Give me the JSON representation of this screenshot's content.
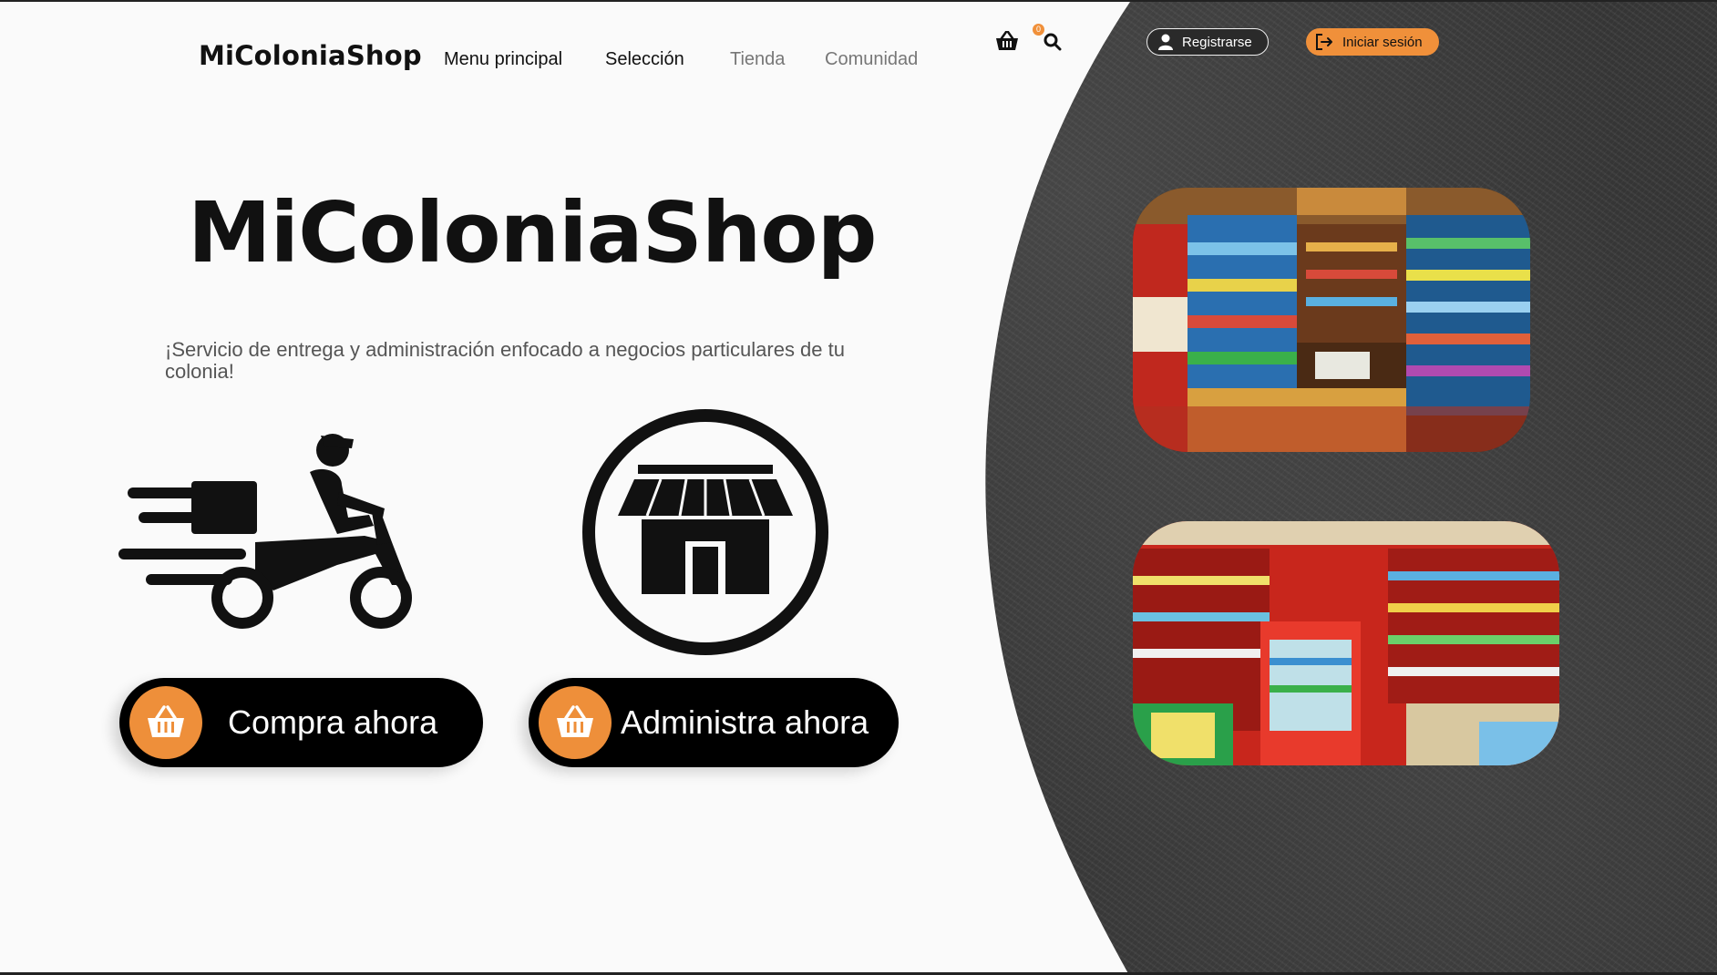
{
  "header": {
    "logo": "MiColoniaShop",
    "nav": [
      {
        "label": "Menu principal"
      },
      {
        "label": "Selección"
      },
      {
        "label": "Tienda"
      },
      {
        "label": "Comunidad"
      }
    ],
    "cart_count": "0",
    "cart_icon": "basket-icon",
    "search_icon": "search-icon",
    "register_label": "Registrarse",
    "login_label": "Iniciar sesión"
  },
  "hero": {
    "title": "MiColoniaShop",
    "subtitle": "¡Servicio de entrega y administración enfocado a negocios particulares de tu colonia!"
  },
  "actions": {
    "buy_label": "Compra ahora",
    "manage_label": "Administra ahora",
    "icon": "basket-icon"
  },
  "colors": {
    "accent": "#f0903a",
    "dark": "#000000",
    "background": "#fafafa"
  }
}
